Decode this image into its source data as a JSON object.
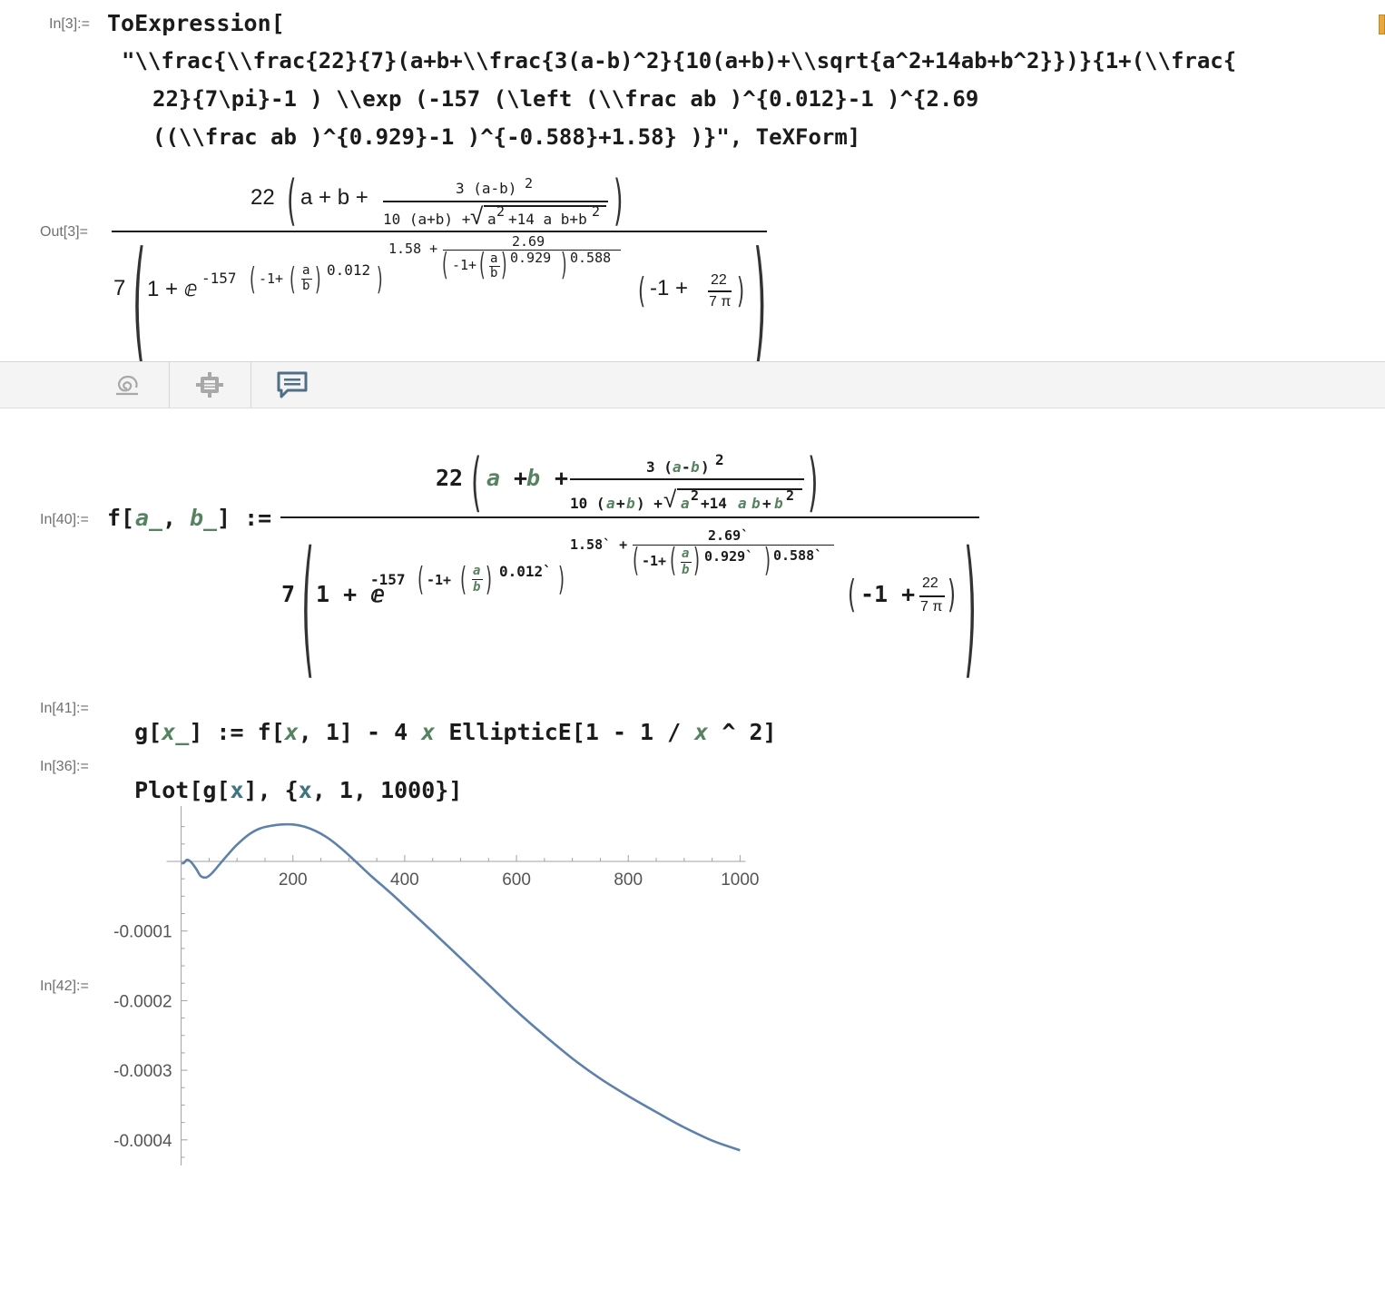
{
  "cell_labels": {
    "in3": "In[3]:=",
    "out3": "Out[3]=",
    "in40": "In[40]:=",
    "in41": "In[41]:=",
    "in36": "In[36]:=",
    "in42": "In[42]:="
  },
  "in3": {
    "line1": "ToExpression[",
    "line2": "\"\\\\frac{\\\\frac{22}{7}(a+b+\\\\frac{3(a-b)^2}{10(a+b)+\\\\sqrt{a^2+14ab+b^2}})}{1+(\\\\frac{",
    "line3": "22}{7\\pi}-1 ) \\\\exp (-157 (\\left (\\\\frac ab )^{0.012}-1 )^{2.69",
    "line4": "((\\\\frac ab )^{0.929}-1 )^{-0.588}+1.58} )}\", TeXForm]"
  },
  "out3": {
    "n22": "22",
    "apb": "a + b +",
    "num3": "3 (a-b)",
    "sq": "2",
    "den10": "10 (a+b) +",
    "radicand": "a",
    "r2": "2",
    "r14": "+14 a b+b",
    "r2b": "2",
    "seven": "7",
    "onepluse": "1 + ⅇ",
    "m157": "-157",
    "m1p": "-1+",
    "fa": "a",
    "fb": "b",
    "e012": "0.012",
    "e158": "1.58 +",
    "e269": "2.69",
    "em1p": "-1+",
    "ea": "a",
    "eb": "b",
    "e0929": "0.929",
    "e0588": "0.588",
    "tail_m1": "-1 +",
    "tail_22": "22",
    "tail_7pi": "7 π"
  },
  "toolbar": {
    "icons": [
      "spiral-icon",
      "gear-icon",
      "comment-icon"
    ]
  },
  "in40": {
    "lhs_f": "f[",
    "lhs_a": "a_",
    "lhs_comma": ", ",
    "lhs_b": "b_",
    "lhs_close": "] :=",
    "n22": "22",
    "a": "a",
    "plus1": " + ",
    "b": "b",
    "plus2": " +",
    "num3": "3 (",
    "na": "a",
    "minus": "-",
    "nb": "b",
    "nclose": ")",
    "sq": "2",
    "den10": "10 (",
    "da": "a",
    "dplus": "+",
    "db": "b",
    "dclose": ") +",
    "ra": "a",
    "r2": "2",
    "r14": "+14 ",
    "rab_a": "a",
    "rab_b": "b",
    "rplus": "+",
    "rb": "b",
    "r2b": "2",
    "seven": "7",
    "onepluse": "1 + ⅇ",
    "m157": "-157",
    "m1p": "-1+",
    "fa": "a",
    "fb": "b",
    "e012": "0.012`",
    "e158": "1.58` +",
    "e269": "2.69`",
    "em1p": "-1+",
    "ea": "a",
    "eb": "b",
    "e0929": "0.929`",
    "e0588": "0.588`",
    "tail_m1": "-1 +",
    "tail_22": "22",
    "tail_7pi": "7 π"
  },
  "in41": {
    "g": "g[",
    "x1": "x_",
    "mid": "] := f[",
    "x2": "x",
    "mid2": ", 1] - 4 ",
    "x3": "x",
    "mid3": " EllipticE[1 - 1 / ",
    "x4": "x",
    "end": " ^ 2]"
  },
  "in36": {
    "plot": "Plot[g[",
    "x1": "x",
    "mid": "], {",
    "x2": "x",
    "end": ", 1, 1000}]"
  },
  "chart_data": {
    "type": "line",
    "title": "",
    "xlabel": "",
    "ylabel": "",
    "xlim": [
      0,
      1000
    ],
    "ylim": [
      -0.00044,
      8e-05
    ],
    "x_ticks": [
      "200",
      "400",
      "600",
      "800",
      "1000"
    ],
    "y_ticks": [
      "-0.0001",
      "-0.0002",
      "-0.0003",
      "-0.0004"
    ],
    "grid": false,
    "color": "#5e81ac",
    "series": [
      {
        "x": [
          1,
          5,
          10,
          15,
          20,
          28,
          35,
          45,
          55,
          70,
          85,
          100,
          120,
          140,
          160,
          180,
          200,
          220,
          240,
          260,
          280,
          300,
          320,
          340,
          360,
          380,
          400,
          450,
          500,
          550,
          600,
          650,
          700,
          750,
          800,
          850,
          900,
          950,
          1000
        ],
        "values": [
          -3e-06,
          -2e-06,
          2.2e-06,
          1e-06,
          -3e-06,
          -1.2e-05,
          -2.1e-05,
          -2.3e-05,
          -1.7e-05,
          -3e-06,
          1.1e-05,
          2.4e-05,
          3.8e-05,
          4.7e-05,
          5.1e-05,
          5.3e-05,
          5.3e-05,
          5e-05,
          4.4e-05,
          3.5e-05,
          2.3e-05,
          9e-06,
          -6e-06,
          -2.1e-05,
          -3.5e-05,
          -4.9e-05,
          -6.4e-05,
          -0.000101,
          -0.000139,
          -0.000177,
          -0.000215,
          -0.00025,
          -0.000283,
          -0.000312,
          -0.000337,
          -0.00036,
          -0.000382,
          -0.000401,
          -0.000415
        ]
      }
    ]
  }
}
